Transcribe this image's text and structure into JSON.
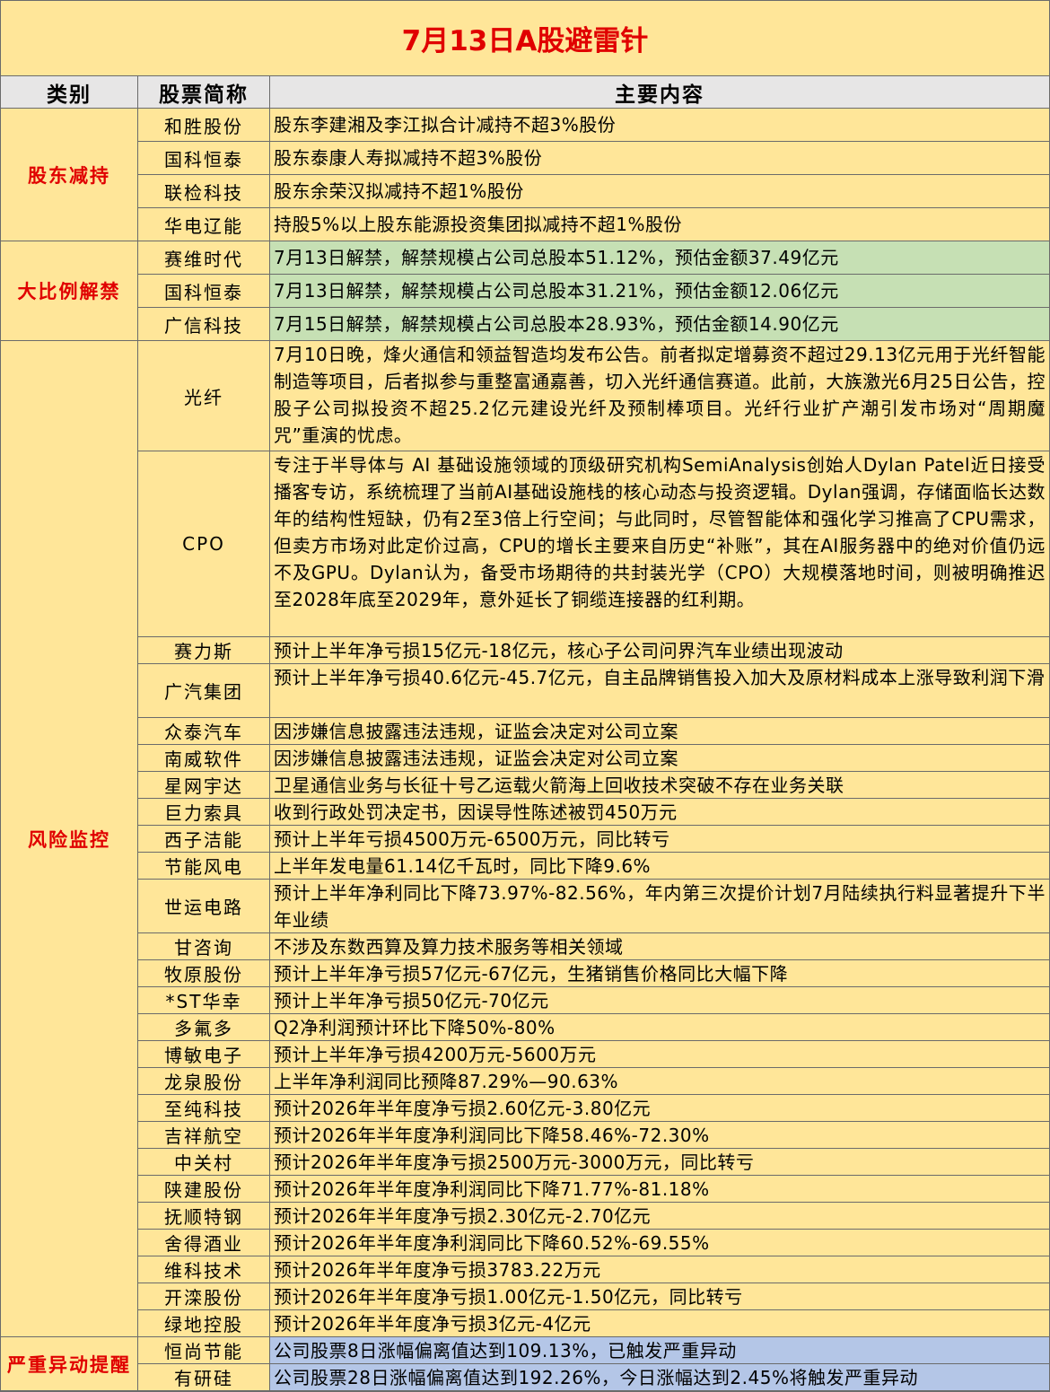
{
  "title": "7月13日A股避雷针",
  "headers": {
    "category": "类别",
    "stock": "股票简称",
    "content": "主要内容"
  },
  "categories": {
    "reduction": "股东减持",
    "unlock": "大比例解禁",
    "risk": "风险监控",
    "abnormal": "严重异动提醒"
  },
  "rows": [
    {
      "name": "和胜股份",
      "content": "股东李建湘及李江拟合计减持不超3%股份"
    },
    {
      "name": "国科恒泰",
      "content": "股东泰康人寿拟减持不超3%股份"
    },
    {
      "name": "联检科技",
      "content": "股东余荣汉拟减持不超1%股份"
    },
    {
      "name": "华电辽能",
      "content": "持股5%以上股东能源投资集团拟减持不超1%股份"
    },
    {
      "name": "赛维时代",
      "content": "7月13日解禁，解禁规模占公司总股本51.12%，预估金额37.49亿元"
    },
    {
      "name": "国科恒泰",
      "content": "7月13日解禁，解禁规模占公司总股本31.21%，预估金额12.06亿元"
    },
    {
      "name": "广信科技",
      "content": "7月15日解禁，解禁规模占公司总股本28.93%，预估金额14.90亿元"
    },
    {
      "name": "光纤",
      "content": "7月10日晚，烽火通信和领益智造均发布公告。前者拟定增募资不超过29.13亿元用于光纤智能制造等项目，后者拟参与重整富通嘉善，切入光纤通信赛道。此前，大族激光6月25日公告，控股子公司拟投资不超25.2亿元建设光纤及预制棒项目。光纤行业扩产潮引发市场对“周期魔咒”重演的忧虑。"
    },
    {
      "name": "CPO",
      "content": "专注于半导体与 AI 基础设施领域的顶级研究机构SemiAnalysis创始人Dylan Patel近日接受播客专访，系统梳理了当前AI基础设施栈的核心动态与投资逻辑。Dylan强调，存储面临长达数年的结构性短缺，仍有2至3倍上行空间；与此同时，尽管智能体和强化学习推高了CPU需求，但卖方市场对此定价过高，CPU的增长主要来自历史“补账”，其在AI服务器中的绝对价值仍远不及GPU。Dylan认为，备受市场期待的共封装光学（CPO）大规模落地时间，则被明确推迟至2028年底至2029年，意外延长了铜缆连接器的红利期。"
    },
    {
      "name": "赛力斯",
      "content": "预计上半年净亏损15亿元-18亿元，核心子公司问界汽车业绩出现波动"
    },
    {
      "name": "广汽集团",
      "content": "预计上半年净亏损40.6亿元-45.7亿元，自主品牌销售投入加大及原材料成本上涨导致利润下滑"
    },
    {
      "name": "众泰汽车",
      "content": "因涉嫌信息披露违法违规，证监会决定对公司立案"
    },
    {
      "name": "南威软件",
      "content": "因涉嫌信息披露违法违规，证监会决定对公司立案"
    },
    {
      "name": "星网宇达",
      "content": "卫星通信业务与长征十号乙运载火箭海上回收技术突破不存在业务关联"
    },
    {
      "name": "巨力索具",
      "content": "收到行政处罚决定书，因误导性陈述被罚450万元"
    },
    {
      "name": "西子洁能",
      "content": "预计上半年亏损4500万元-6500万元，同比转亏"
    },
    {
      "name": "节能风电",
      "content": "上半年发电量61.14亿千瓦时，同比下降9.6%"
    },
    {
      "name": "世运电路",
      "content": "预计上半年净利同比下降73.97%-82.56%，年内第三次提价计划7月陆续执行料显著提升下半年业绩"
    },
    {
      "name": "甘咨询",
      "content": "不涉及东数西算及算力技术服务等相关领域"
    },
    {
      "name": "牧原股份",
      "content": "预计上半年净亏损57亿元-67亿元，生猪销售价格同比大幅下降"
    },
    {
      "name": "*ST华幸",
      "content": "预计上半年净亏损50亿元-70亿元"
    },
    {
      "name": "多氟多",
      "content": "Q2净利润预计环比下降50%-80%"
    },
    {
      "name": "博敏电子",
      "content": "预计上半年净亏损4200万元-5600万元"
    },
    {
      "name": "龙泉股份",
      "content": "上半年净利润同比预降87.29%—90.63%"
    },
    {
      "name": "至纯科技",
      "content": "预计2026年半年度净亏损2.60亿元-3.80亿元"
    },
    {
      "name": "吉祥航空",
      "content": "预计2026年半年度净利润同比下降58.46%-72.30%"
    },
    {
      "name": "中关村",
      "content": "预计2026年半年度净亏损2500万元-3000万元，同比转亏"
    },
    {
      "name": "陕建股份",
      "content": "预计2026年半年度净利润同比下降71.77%-81.18%"
    },
    {
      "name": "抚顺特钢",
      "content": "预计2026年半年度净亏损2.30亿元-2.70亿元"
    },
    {
      "name": "舍得酒业",
      "content": "预计2026年半年度净利润同比下降60.52%-69.55%"
    },
    {
      "name": "维科技术",
      "content": "预计2026年半年度净亏损3783.22万元"
    },
    {
      "name": "开滦股份",
      "content": "预计2026年半年度净亏损1.00亿元-1.50亿元，同比转亏"
    },
    {
      "name": "绿地控股",
      "content": "预计2026年半年度净亏损3亿元-4亿元"
    },
    {
      "name": "恒尚节能",
      "content": "公司股票8日涨幅偏离值达到109.13%，已触发严重异动"
    },
    {
      "name": "有研硅",
      "content": "公司股票28日涨幅偏离值达到192.26%，今日涨幅达到2.45%将触发严重异动"
    }
  ],
  "colors": {
    "title_bg": "#ffe699",
    "title_text": "#e00000",
    "header_bg": "#e7e6e6",
    "row_bg": "#ffe699",
    "unlock_bg": "#c6e0b4",
    "abnormal_bg": "#b4c6e7"
  }
}
